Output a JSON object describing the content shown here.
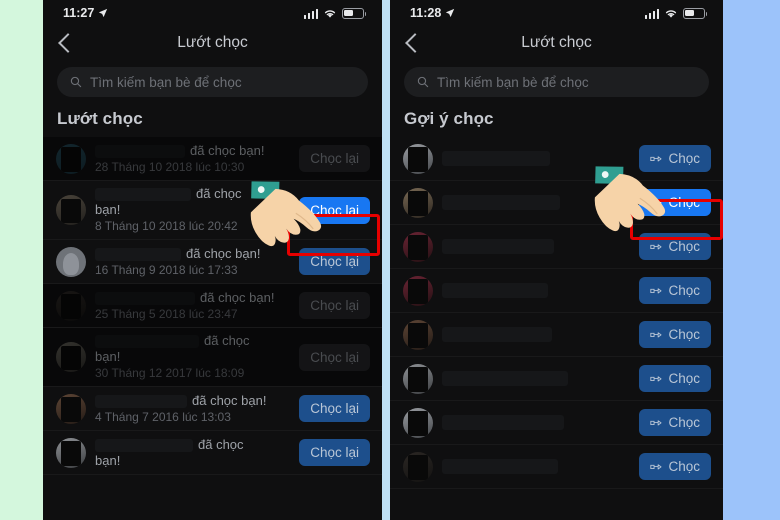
{
  "colors": {
    "gutter_left": "#d4f7dd",
    "gutter_divider": "#bfe0f5",
    "gutter_right": "#9cc3fa",
    "screen_bg": "#0f0f10",
    "accent_blue": "#1877f2",
    "highlight_red": "#e60000",
    "cuff_teal": "#2f9e91",
    "skin": "#f6d3a8"
  },
  "left_panel": {
    "status_bar": {
      "time": "11:27",
      "location_icon": "location-arrow-icon",
      "signal_icon": "cellular-signal-icon",
      "wifi_icon": "wifi-icon",
      "battery_icon": "battery-icon"
    },
    "nav": {
      "back_icon": "back-chevron-icon",
      "title": "Lướt chọc"
    },
    "search": {
      "icon": "search-icon",
      "placeholder": "Tìm kiếm bạn bè để chọc"
    },
    "section_title": "Lướt chọc",
    "rows": [
      {
        "avatar": "av-a",
        "message": "đã chọc bạn!",
        "time": "28 Tháng 10 2018 lúc 10:30",
        "button": "Chọc lại",
        "style": "ghost",
        "wrap": false
      },
      {
        "avatar": "av-b",
        "message": "đã chọc bạn!",
        "time": "8 Tháng 10 2018 lúc 20:42",
        "button": "Chọc lại",
        "style": "primary",
        "wrap": true
      },
      {
        "avatar": "av-c",
        "message": "đã chọc bạn!",
        "time": "16 Tháng 9 2018 lúc 17:33",
        "button": "Chọc lại",
        "style": "dim",
        "wrap": false
      },
      {
        "avatar": "av-d",
        "message": "đã chọc bạn!",
        "time": "25 Tháng 5 2018 lúc 23:47",
        "button": "Chọc lại",
        "style": "ghost",
        "wrap": false
      },
      {
        "avatar": "av-e",
        "message": "đã chọc bạn!",
        "time": "30 Tháng 12 2017 lúc 18:09",
        "button": "Chọc lại",
        "style": "ghost",
        "wrap": true
      },
      {
        "avatar": "av-f",
        "message": "đã chọc bạn!",
        "time": "4 Tháng 7 2016 lúc 13:03",
        "button": "Chọc lại",
        "style": "dim",
        "wrap": false
      },
      {
        "avatar": "av-g",
        "message": "đã chọc bạn!",
        "time": "",
        "button": "Chọc lại",
        "style": "dim",
        "wrap": true
      }
    ]
  },
  "right_panel": {
    "status_bar": {
      "time": "11:28",
      "location_icon": "location-arrow-icon",
      "signal_icon": "cellular-signal-icon",
      "wifi_icon": "wifi-icon",
      "battery_icon": "battery-icon"
    },
    "nav": {
      "back_icon": "back-chevron-icon",
      "title": "Lướt chọc"
    },
    "search": {
      "icon": "search-icon",
      "placeholder": "Tìm kiếm bạn bè để chọc"
    },
    "section_title": "Gợi ý chọc",
    "poke_icon": "pointing-hand-icon",
    "rows": [
      {
        "avatar": "av-j",
        "button": "Chọc",
        "style": "dim"
      },
      {
        "avatar": "av-i",
        "button": "Chọc",
        "style": "primary"
      },
      {
        "avatar": "av-h",
        "button": "Chọc",
        "style": "dim"
      },
      {
        "avatar": "av-h",
        "button": "Chọc",
        "style": "dim"
      },
      {
        "avatar": "av-f",
        "button": "Chọc",
        "style": "dim"
      },
      {
        "avatar": "av-g",
        "button": "Chọc",
        "style": "dim"
      },
      {
        "avatar": "av-j",
        "button": "Chọc",
        "style": "dim"
      },
      {
        "avatar": "av-d",
        "button": "Chọc",
        "style": "dim"
      }
    ]
  },
  "annotations": {
    "left_highlight_target": "Chọc lại",
    "right_highlight_target": "Chọc",
    "cursor_icon": "pointing-hand-cursor"
  }
}
